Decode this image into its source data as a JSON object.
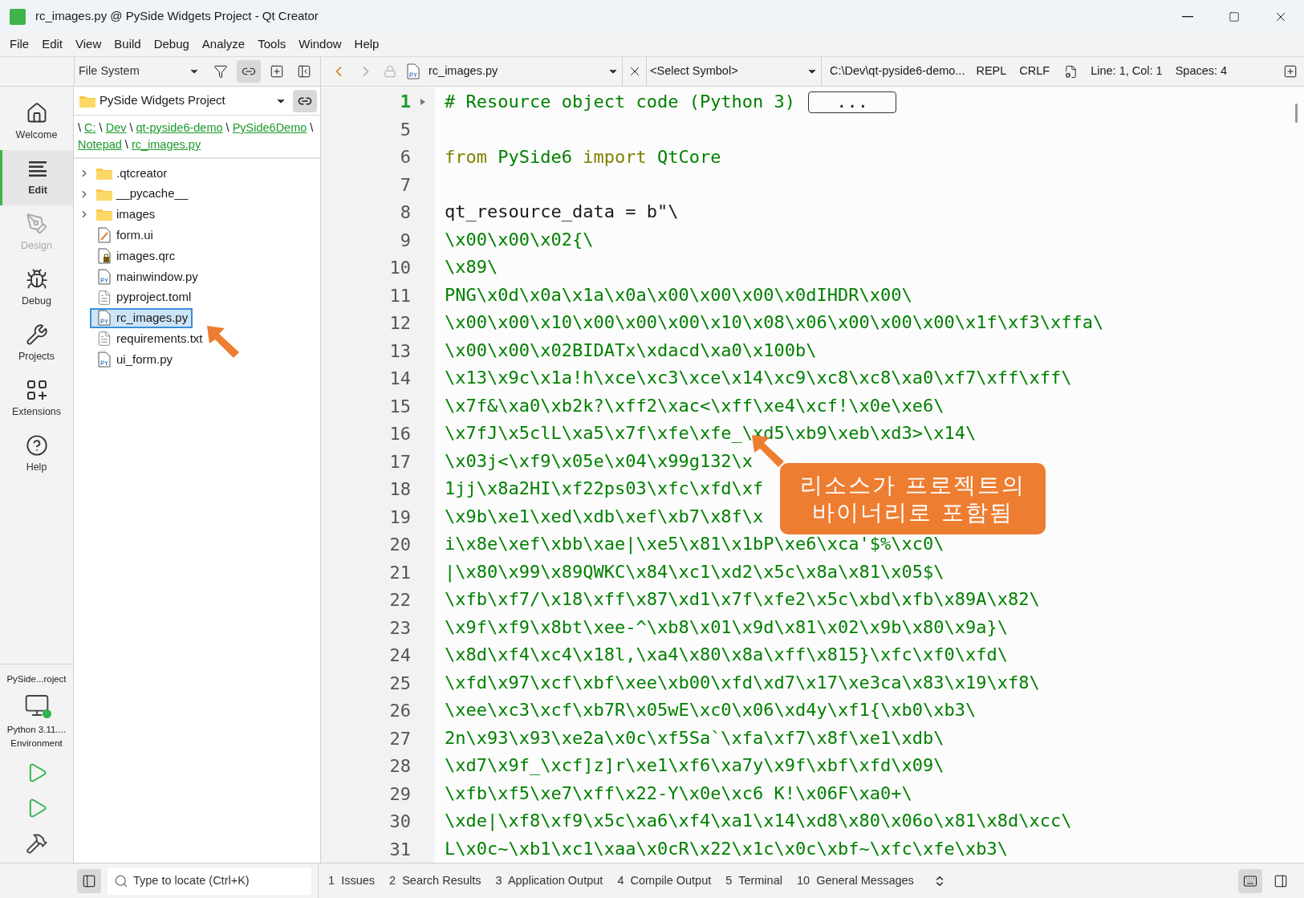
{
  "window": {
    "title": "rc_images.py @ PySide Widgets Project - Qt Creator"
  },
  "menu": [
    "File",
    "Edit",
    "View",
    "Build",
    "Debug",
    "Analyze",
    "Tools",
    "Window",
    "Help"
  ],
  "sidebar_toolbar": {
    "view": "File System"
  },
  "editor_toolbar": {
    "file": "rc_images.py",
    "symbol": "<Select Symbol>",
    "path": "C:\\Dev\\qt-pyside6-demo...",
    "repl": "REPL",
    "line_ending": "CRLF",
    "position": "Line: 1, Col: 1",
    "indent": "Spaces: 4"
  },
  "modes": [
    {
      "label": "Welcome",
      "kind": "home",
      "selected": false,
      "disabled": false
    },
    {
      "label": "Edit",
      "kind": "edit",
      "selected": true,
      "disabled": false
    },
    {
      "label": "Design",
      "kind": "design",
      "selected": false,
      "disabled": true
    },
    {
      "label": "Debug",
      "kind": "debug",
      "selected": false,
      "disabled": false
    },
    {
      "label": "Projects",
      "kind": "projects",
      "selected": false,
      "disabled": false
    },
    {
      "label": "Extensions",
      "kind": "extensions",
      "selected": false,
      "disabled": false
    },
    {
      "label": "Help",
      "kind": "help",
      "selected": false,
      "disabled": false
    }
  ],
  "kit": {
    "project": "PySide...roject",
    "lines": [
      "Python 3.11....",
      "Environment"
    ]
  },
  "project": {
    "name": "PySide Widgets Project",
    "breadcrumb": {
      "separator": "\\",
      "parts": [
        "C:",
        "Dev",
        "qt-pyside6-demo",
        "PySide6Demo",
        "Notepad",
        "rc_images.py"
      ]
    },
    "tree": [
      {
        "name": ".qtcreator",
        "kind": "folder",
        "expanded": false,
        "selected": false
      },
      {
        "name": "__pycache__",
        "kind": "folder",
        "expanded": false,
        "selected": false
      },
      {
        "name": "images",
        "kind": "folder",
        "expanded": false,
        "selected": false
      },
      {
        "name": "form.ui",
        "kind": "ui",
        "selected": false
      },
      {
        "name": "images.qrc",
        "kind": "qrc",
        "selected": false
      },
      {
        "name": "mainwindow.py",
        "kind": "py",
        "selected": false
      },
      {
        "name": "pyproject.toml",
        "kind": "text",
        "selected": false
      },
      {
        "name": "rc_images.py",
        "kind": "py",
        "selected": true
      },
      {
        "name": "requirements.txt",
        "kind": "text",
        "selected": false
      },
      {
        "name": "ui_form.py",
        "kind": "py",
        "selected": false
      }
    ]
  },
  "editor": {
    "lines": [
      {
        "number": "1",
        "current": true,
        "folded": "...",
        "segments": [
          {
            "text": "# Resource object code (Python 3)",
            "kind": "comment"
          }
        ]
      },
      {
        "number": "5",
        "current": false
      },
      {
        "number": "6",
        "current": false,
        "segments": [
          {
            "text": "from",
            "kind": "keyword"
          },
          {
            "text": " PySide6 ",
            "kind": "string"
          },
          {
            "text": "import",
            "kind": "keyword"
          },
          {
            "text": " QtCore",
            "kind": "string"
          }
        ]
      },
      {
        "number": "7",
        "current": false
      },
      {
        "number": "8",
        "current": false,
        "segments": [
          {
            "text": "qt_resource_data = b\"\\",
            "kind": "plain"
          }
        ]
      },
      {
        "number": "9",
        "current": false,
        "segments": [
          {
            "text": "\\x00\\x00\\x02{\\",
            "kind": "string"
          }
        ]
      },
      {
        "number": "10",
        "current": false,
        "segments": [
          {
            "text": "\\x89\\",
            "kind": "string"
          }
        ]
      },
      {
        "number": "11",
        "current": false,
        "segments": [
          {
            "text": "PNG\\x0d\\x0a\\x1a\\x0a\\x00\\x00\\x00\\x0dIHDR\\x00\\",
            "kind": "string"
          }
        ]
      },
      {
        "number": "12",
        "current": false,
        "segments": [
          {
            "text": "\\x00\\x00\\x10\\x00\\x00\\x00\\x10\\x08\\x06\\x00\\x00\\x00\\x1f\\xf3\\xffa\\",
            "kind": "string"
          }
        ]
      },
      {
        "number": "13",
        "current": false,
        "segments": [
          {
            "text": "\\x00\\x00\\x02BIDATx\\xdacd\\xa0\\x100b\\",
            "kind": "string"
          }
        ]
      },
      {
        "number": "14",
        "current": false,
        "segments": [
          {
            "text": "\\x13\\x9c\\x1a!h\\xce\\xc3\\xce\\x14\\xc9\\xc8\\xc8\\xa0\\xf7\\xff\\xff\\",
            "kind": "string"
          }
        ]
      },
      {
        "number": "15",
        "current": false,
        "segments": [
          {
            "text": "\\x7f&\\xa0\\xb2k?\\xff2\\xac<\\xff\\xe4\\xcf!\\x0e\\xe6\\",
            "kind": "string"
          }
        ]
      },
      {
        "number": "16",
        "current": false,
        "segments": [
          {
            "text": "\\x7fJ\\x5clL\\xa5\\x7f\\xfe\\xfe_\\xd5\\xb9\\xeb\\xd3>\\x14\\",
            "kind": "string"
          }
        ]
      },
      {
        "number": "17",
        "current": false,
        "segments": [
          {
            "text": "\\x03j<\\xf9\\x05e\\x04\\x99g132\\x",
            "kind": "string"
          }
        ]
      },
      {
        "number": "18",
        "current": false,
        "segments": [
          {
            "text": "1jj\\x8a2HI\\xf22ps03\\xfc\\xfd\\xf",
            "kind": "string"
          }
        ]
      },
      {
        "number": "19",
        "current": false,
        "segments": [
          {
            "text": "\\x9b\\xe1\\xed\\xdb\\xef\\xb7\\x8f\\x",
            "kind": "string"
          }
        ]
      },
      {
        "number": "20",
        "current": false,
        "segments": [
          {
            "text": "i\\x8e\\xef\\xbb\\xae|\\xe5\\x81\\x1bP\\xe6\\xca'$%\\xc0\\",
            "kind": "string"
          }
        ]
      },
      {
        "number": "21",
        "current": false,
        "segments": [
          {
            "text": "|\\x80\\x99\\x89QWKC\\x84\\xc1\\xd2\\x5c\\x8a\\x81\\x05$\\",
            "kind": "string"
          }
        ]
      },
      {
        "number": "22",
        "current": false,
        "segments": [
          {
            "text": "\\xfb\\xf7/\\x18\\xff\\x87\\xd1\\x7f\\xfe2\\x5c\\xbd\\xfb\\x89A\\x82\\",
            "kind": "string"
          }
        ]
      },
      {
        "number": "23",
        "current": false,
        "segments": [
          {
            "text": "\\x9f\\xf9\\x8bt\\xee-^\\xb8\\x01\\x9d\\x81\\x02\\x9b\\x80\\x9a}\\",
            "kind": "string"
          }
        ]
      },
      {
        "number": "24",
        "current": false,
        "segments": [
          {
            "text": "\\x8d\\xf4\\xc4\\x18l,\\xa4\\x80\\x8a\\xff\\x815}\\xfc\\xf0\\xfd\\",
            "kind": "string"
          }
        ]
      },
      {
        "number": "25",
        "current": false,
        "segments": [
          {
            "text": "\\xfd\\x97\\xcf\\xbf\\xee\\xb00\\xfd\\xd7\\x17\\xe3ca\\x83\\x19\\xf8\\",
            "kind": "string"
          }
        ]
      },
      {
        "number": "26",
        "current": false,
        "segments": [
          {
            "text": "\\xee\\xc3\\xcf\\xb7R\\x05wE\\xc0\\x06\\xd4y\\xf1{\\xb0\\xb3\\",
            "kind": "string"
          }
        ]
      },
      {
        "number": "27",
        "current": false,
        "segments": [
          {
            "text": "2n\\x93\\x93\\xe2a\\x0c\\xf5Sa`\\xfa\\xf7\\x8f\\xe1\\xdb\\",
            "kind": "string"
          }
        ]
      },
      {
        "number": "28",
        "current": false,
        "segments": [
          {
            "text": "\\xd7\\x9f_\\xcf]z]r\\xe1\\xf6\\xa7y\\x9f\\xbf\\xfd\\x09\\",
            "kind": "string"
          }
        ]
      },
      {
        "number": "29",
        "current": false,
        "segments": [
          {
            "text": "\\xfb\\xf5\\xe7\\xff\\x22-Y\\x0e\\xc6 K!\\x06F\\xa0+\\",
            "kind": "string"
          }
        ]
      },
      {
        "number": "30",
        "current": false,
        "segments": [
          {
            "text": "\\xde|\\xf8\\xf9\\x5c\\xa6\\xf4\\xa1\\x14\\xd8\\x80\\x06o\\x81\\x8d\\xcc\\",
            "kind": "string"
          }
        ]
      },
      {
        "number": "31",
        "current": false,
        "segments": [
          {
            "text": "L\\x0c~\\xb1\\xc1\\xaa\\x0cR\\x22\\x1c\\x0c\\xbf~\\xfc\\xfe\\xb3\\",
            "kind": "string"
          }
        ]
      }
    ]
  },
  "callout": {
    "lines": [
      "리소스가 프로젝트의",
      "바이너리로 포함됨"
    ]
  },
  "status_bar": {
    "locate": {
      "placeholder": "Type to locate (Ctrl+K)"
    },
    "panes": [
      {
        "number": "1",
        "label": "Issues"
      },
      {
        "number": "2",
        "label": "Search Results"
      },
      {
        "number": "3",
        "label": "Application Output"
      },
      {
        "number": "4",
        "label": "Compile Output"
      },
      {
        "number": "5",
        "label": "Terminal"
      },
      {
        "number": "10",
        "label": "General Messages"
      }
    ]
  }
}
